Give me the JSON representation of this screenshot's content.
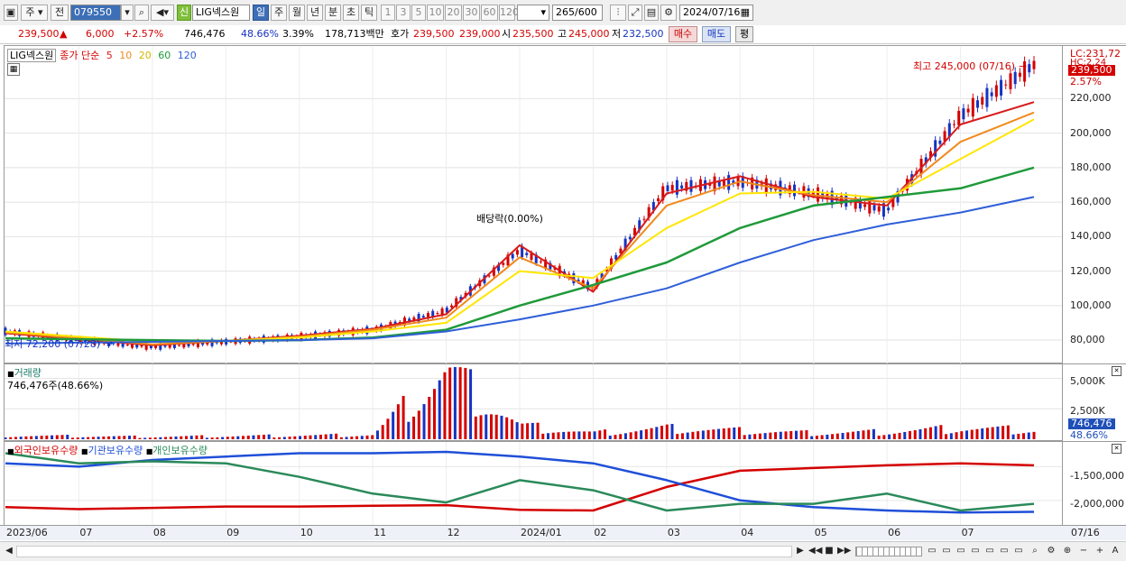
{
  "toolbar": {
    "period_label": "주",
    "prev_label": "전",
    "stock_code": "079550",
    "sin_label": "신",
    "stock_name": "LIG넥스원",
    "tabs": [
      "일",
      "주",
      "월",
      "년",
      "분",
      "초",
      "틱"
    ],
    "tick_options": [
      "1",
      "3",
      "5",
      "10",
      "20",
      "30",
      "60",
      "120"
    ],
    "count_value": "265",
    "count_total": "/600",
    "date_value": "2024/07/16"
  },
  "quote": {
    "price": "239,500",
    "change": "6,000",
    "change_pct": "+2.57%",
    "volume": "746,476",
    "volume_ratio": "48.66%",
    "turnover": "3.39%",
    "amount": "178,713백만",
    "bid_label": "호가",
    "bid": "239,500",
    "ask": "239,000",
    "open_label": "시",
    "open": "235,500",
    "high_label": "고",
    "high": "245,000",
    "low_label": "저",
    "low": "232,500",
    "buy_label": "매수",
    "sell_label": "매도",
    "eval_label": "평"
  },
  "price_pane": {
    "name_label": "LIG넥스원",
    "ma_label": "종가 단순",
    "ma_periods": [
      "5",
      "10",
      "20",
      "60",
      "120"
    ],
    "ma_colors": {
      "5": "#d81b1b",
      "10": "#f08a1c",
      "20": "#ffe600",
      "60": "#1f9a3a",
      "120": "#2f5fd8"
    },
    "high_annotation": "최고 245,000 (07/16)",
    "low_annotation": "최저 72,200 (07/28)",
    "dividend_annotation": "배당락(0.00%)",
    "lc_label": "LC:231,72",
    "hc_label": "HC:2.24",
    "price_badge": "239,500",
    "pct_badge": "2.57%",
    "y_ticks": [
      "220,000",
      "200,000",
      "180,000",
      "160,000",
      "140,000",
      "120,000",
      "100,000",
      "80,000"
    ]
  },
  "volume_pane": {
    "title": "거래량",
    "value_label": "746,476주(48.66%)",
    "y_ticks": [
      "5,000K",
      "2,500K"
    ],
    "badge": "746,476",
    "badge_pct": "48.66%"
  },
  "holdings_pane": {
    "series_labels": [
      "외국인보유수량",
      "기관보유수량",
      "개인보유수량"
    ],
    "y_ticks": [
      "-1,500,000",
      "-2,000,000"
    ]
  },
  "x_axis": {
    "labels": [
      "2023/06",
      "07",
      "08",
      "09",
      "10",
      "11",
      "12",
      "2024/01",
      "02",
      "03",
      "04",
      "05",
      "06",
      "07"
    ],
    "end_label": "07/16"
  },
  "chart_data": [
    {
      "type": "line",
      "title": "LIG넥스원",
      "x": [
        "2023/06",
        "07",
        "08",
        "09",
        "10",
        "11",
        "12",
        "2024/01",
        "02",
        "03",
        "04",
        "05",
        "06",
        "07",
        "07/16"
      ],
      "series": [
        {
          "name": "종가",
          "values": [
            85000,
            80000,
            76000,
            79000,
            82000,
            86000,
            97000,
            132000,
            110000,
            168000,
            172000,
            165000,
            155000,
            210000,
            239500
          ]
        },
        {
          "name": "5",
          "values": [
            84000,
            80500,
            77000,
            79500,
            82500,
            86500,
            95000,
            135000,
            108000,
            165000,
            175000,
            163000,
            158000,
            205000,
            218000
          ]
        },
        {
          "name": "10",
          "values": [
            84500,
            81000,
            77500,
            79500,
            82000,
            86000,
            93000,
            128000,
            110000,
            158000,
            172000,
            164000,
            160000,
            195000,
            212000
          ]
        },
        {
          "name": "20",
          "values": [
            85000,
            82000,
            79000,
            79500,
            81500,
            85000,
            90000,
            120000,
            116000,
            145000,
            165000,
            166000,
            162000,
            185000,
            208000
          ]
        },
        {
          "name": "60",
          "values": [
            81000,
            80500,
            80000,
            79500,
            80000,
            81500,
            86000,
            100000,
            112000,
            125000,
            145000,
            158000,
            163000,
            168000,
            180000
          ]
        },
        {
          "name": "120",
          "values": [
            78000,
            78500,
            79000,
            79500,
            80000,
            81000,
            85000,
            92000,
            100000,
            110000,
            125000,
            138000,
            147000,
            154000,
            163000
          ]
        }
      ],
      "ylim": [
        68000,
        250000
      ]
    },
    {
      "type": "bar",
      "title": "거래량",
      "categories": [
        "2023/06",
        "07",
        "08",
        "09",
        "10",
        "11",
        "12",
        "2024/01",
        "02",
        "03",
        "04",
        "05",
        "06",
        "07",
        "07/16"
      ],
      "values": [
        300,
        250,
        200,
        250,
        300,
        350,
        5500,
        1100,
        500,
        900,
        700,
        500,
        600,
        900,
        746
      ],
      "ylim": [
        0,
        6000
      ]
    },
    {
      "type": "line",
      "x": [
        "2023/06",
        "07",
        "08",
        "09",
        "10",
        "11",
        "12",
        "2024/01",
        "02",
        "03",
        "04",
        "05",
        "06",
        "07",
        "07/16"
      ],
      "series": [
        {
          "name": "외국인보유수량",
          "values": [
            -2100000,
            -2130000,
            -2110000,
            -2090000,
            -2090000,
            -2080000,
            -2070000,
            -2140000,
            -2150000,
            -1800000,
            -1560000,
            -1520000,
            -1480000,
            -1450000,
            -1480000
          ]
        },
        {
          "name": "기관보유수량",
          "values": [
            -1450000,
            -1500000,
            -1400000,
            -1350000,
            -1300000,
            -1300000,
            -1280000,
            -1350000,
            -1450000,
            -1700000,
            -2000000,
            -2100000,
            -2150000,
            -2180000,
            -2170000
          ]
        },
        {
          "name": "개인보유수량",
          "values": [
            -1300000,
            -1450000,
            -1420000,
            -1450000,
            -1650000,
            -1900000,
            -2030000,
            -1700000,
            -1850000,
            -2150000,
            -2050000,
            -2050000,
            -1900000,
            -2150000,
            -2050000
          ]
        }
      ],
      "ylim": [
        -2350000,
        -1200000
      ]
    }
  ]
}
